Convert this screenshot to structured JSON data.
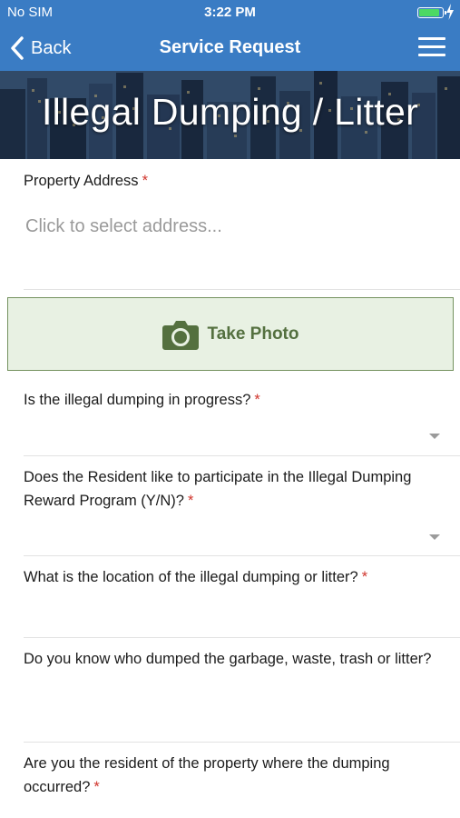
{
  "status_bar": {
    "carrier": "No SIM",
    "time": "3:22 PM",
    "battery_level": 0.9,
    "battery_color": "#4cd964"
  },
  "nav": {
    "back_label": "Back",
    "title": "Service Request",
    "back_icon": "chevron-left-icon",
    "menu_icon": "hamburger-menu-icon",
    "color": "#3a7cc4"
  },
  "hero": {
    "title": "Illegal Dumping / Litter"
  },
  "form": {
    "required_marker": "*",
    "required_color": "#d0352d",
    "address": {
      "label": "Property Address",
      "placeholder": "Click to select address..."
    },
    "photo_button": {
      "label": "Take Photo",
      "icon": "camera-icon",
      "color": "#54703f"
    },
    "questions": [
      {
        "label": "Is the illegal dumping in progress?",
        "required": true,
        "type": "dropdown"
      },
      {
        "label": "Does the Resident like to participate in the Illegal Dumping Reward Program (Y/N)?",
        "required": true,
        "type": "dropdown"
      },
      {
        "label": "What is the location of the illegal dumping or litter?",
        "required": true,
        "type": "text"
      },
      {
        "label": "Do you know who dumped the garbage, waste, trash or litter?",
        "required": false,
        "type": "text"
      },
      {
        "label": "Are you the resident of the property where the dumping occurred?",
        "required": true,
        "type": "text"
      }
    ]
  }
}
